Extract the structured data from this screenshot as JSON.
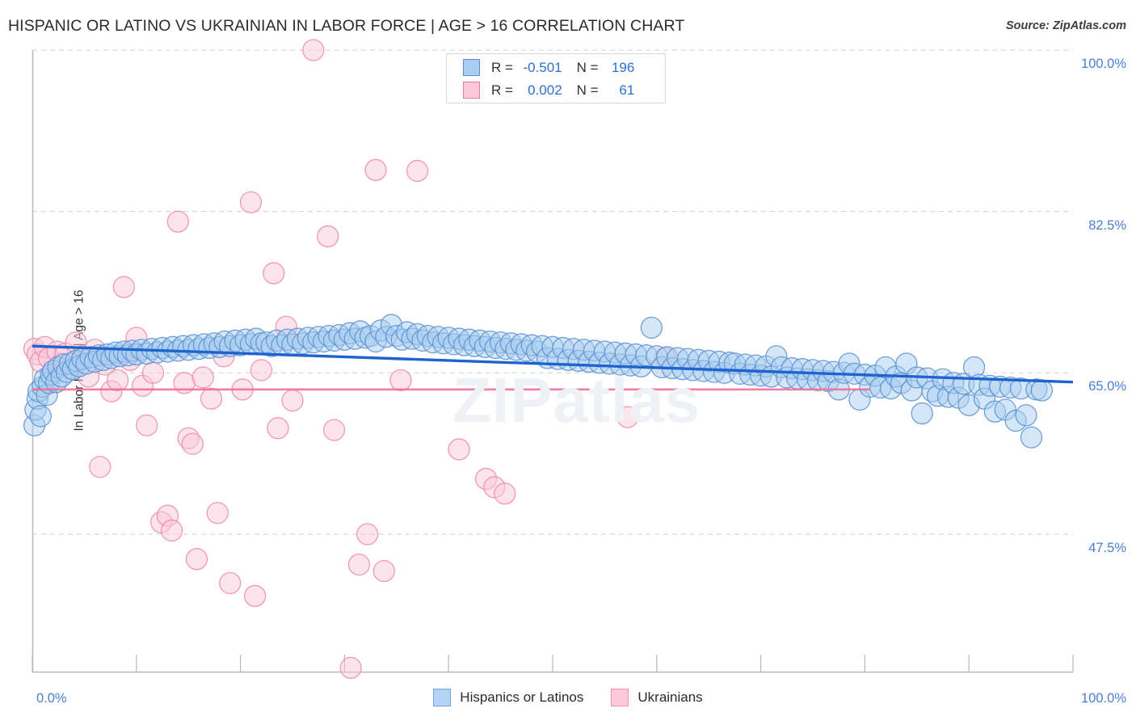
{
  "header": {
    "title": "HISPANIC OR LATINO VS UKRAINIAN IN LABOR FORCE | AGE > 16 CORRELATION CHART",
    "source": "Source: ZipAtlas.com"
  },
  "watermark": "ZIPatlas",
  "stats_legend": {
    "rows": [
      {
        "series": "Hispanics or Latinos",
        "color": "#aacdf2",
        "r_label": "R =",
        "r_value": "-0.501",
        "n_label": "N =",
        "n_value": "196"
      },
      {
        "series": "Ukrainians",
        "color": "#fbc9da",
        "r_label": "R =",
        "r_value": "0.002",
        "n_label": "N =",
        "n_value": "61"
      }
    ]
  },
  "bottom_legend": {
    "items": [
      {
        "label": "Hispanics or Latinos",
        "color": "#b5d4f5"
      },
      {
        "label": "Ukrainians",
        "color": "#fbc9da"
      }
    ]
  },
  "chart_data": {
    "type": "scatter",
    "title": "HISPANIC OR LATINO VS UKRAINIAN IN LABOR FORCE | AGE > 16 CORRELATION CHART",
    "xlabel": "",
    "ylabel": "In Labor Force | Age > 16",
    "xlim": [
      0,
      100
    ],
    "ylim": [
      32.5,
      100
    ],
    "grid": true,
    "legend_position": "bottom-center",
    "x_ticks": [
      "0.0%",
      "100.0%"
    ],
    "x_tick_values": [
      0,
      100
    ],
    "y_ticks": [
      "100.0%",
      "82.5%",
      "65.0%",
      "47.5%"
    ],
    "y_tick_values": [
      100.0,
      82.5,
      65.0,
      47.5
    ],
    "series": [
      {
        "name": "Hispanics or Latinos",
        "color": "#a9cdf0",
        "stroke": "#5b90d4",
        "r": -0.501,
        "n": 196,
        "trendline": {
          "x0": 0,
          "y0": 67.9,
          "x1": 100,
          "y1": 64.0,
          "color": "#1f63d0"
        },
        "points": [
          [
            0.2,
            59.3
          ],
          [
            0.3,
            61.0
          ],
          [
            0.5,
            62.2
          ],
          [
            0.6,
            63.0
          ],
          [
            0.8,
            60.3
          ],
          [
            1.0,
            63.5
          ],
          [
            1.2,
            64.3
          ],
          [
            1.4,
            62.6
          ],
          [
            1.6,
            63.9
          ],
          [
            1.8,
            64.8
          ],
          [
            2.0,
            65.2
          ],
          [
            2.3,
            64.0
          ],
          [
            2.5,
            65.6
          ],
          [
            2.8,
            64.6
          ],
          [
            3.0,
            65.9
          ],
          [
            3.3,
            65.1
          ],
          [
            3.6,
            66.0
          ],
          [
            3.9,
            65.4
          ],
          [
            4.2,
            66.3
          ],
          [
            4.5,
            65.7
          ],
          [
            4.8,
            66.5
          ],
          [
            5.2,
            66.0
          ],
          [
            5.6,
            66.7
          ],
          [
            6.0,
            66.2
          ],
          [
            6.4,
            66.9
          ],
          [
            6.8,
            66.4
          ],
          [
            7.2,
            67.0
          ],
          [
            7.6,
            66.6
          ],
          [
            8.0,
            67.2
          ],
          [
            8.4,
            66.8
          ],
          [
            8.8,
            67.3
          ],
          [
            9.2,
            66.9
          ],
          [
            9.6,
            67.4
          ],
          [
            10.0,
            67.0
          ],
          [
            10.5,
            67.5
          ],
          [
            11.0,
            67.1
          ],
          [
            11.5,
            67.6
          ],
          [
            12.0,
            67.2
          ],
          [
            12.5,
            67.7
          ],
          [
            13.0,
            67.3
          ],
          [
            13.5,
            67.8
          ],
          [
            14.0,
            67.4
          ],
          [
            14.5,
            67.9
          ],
          [
            15.0,
            67.5
          ],
          [
            15.5,
            68.0
          ],
          [
            16.0,
            67.6
          ],
          [
            16.5,
            68.1
          ],
          [
            17.0,
            67.7
          ],
          [
            17.5,
            68.2
          ],
          [
            18.0,
            67.8
          ],
          [
            18.5,
            68.4
          ],
          [
            19.0,
            67.9
          ],
          [
            19.5,
            68.5
          ],
          [
            20.0,
            68.0
          ],
          [
            20.5,
            68.6
          ],
          [
            21.0,
            68.1
          ],
          [
            21.5,
            68.7
          ],
          [
            22.0,
            68.2
          ],
          [
            22.5,
            68.3
          ],
          [
            23.0,
            67.9
          ],
          [
            23.5,
            68.5
          ],
          [
            24.0,
            68.0
          ],
          [
            24.5,
            68.6
          ],
          [
            25.0,
            68.1
          ],
          [
            25.5,
            68.7
          ],
          [
            26.0,
            68.2
          ],
          [
            26.5,
            68.8
          ],
          [
            27.0,
            68.3
          ],
          [
            27.5,
            68.9
          ],
          [
            28.0,
            68.4
          ],
          [
            28.5,
            69.0
          ],
          [
            29.0,
            68.5
          ],
          [
            29.5,
            69.1
          ],
          [
            30.0,
            68.6
          ],
          [
            30.5,
            69.3
          ],
          [
            31.0,
            68.7
          ],
          [
            31.5,
            69.5
          ],
          [
            32.0,
            68.8
          ],
          [
            32.5,
            69.0
          ],
          [
            33.0,
            68.4
          ],
          [
            33.5,
            69.6
          ],
          [
            34.0,
            68.9
          ],
          [
            34.5,
            70.2
          ],
          [
            35.0,
            69.0
          ],
          [
            35.5,
            68.6
          ],
          [
            36.0,
            69.4
          ],
          [
            36.5,
            68.7
          ],
          [
            37.0,
            69.2
          ],
          [
            37.5,
            68.5
          ],
          [
            38.0,
            69.0
          ],
          [
            38.5,
            68.3
          ],
          [
            39.0,
            68.9
          ],
          [
            39.5,
            68.2
          ],
          [
            40.0,
            68.8
          ],
          [
            40.5,
            68.1
          ],
          [
            41.0,
            68.7
          ],
          [
            41.5,
            68.0
          ],
          [
            42.0,
            68.6
          ],
          [
            42.5,
            67.9
          ],
          [
            43.0,
            68.5
          ],
          [
            43.5,
            67.8
          ],
          [
            44.0,
            68.4
          ],
          [
            44.5,
            67.7
          ],
          [
            45.0,
            68.3
          ],
          [
            45.5,
            67.6
          ],
          [
            46.0,
            68.2
          ],
          [
            46.5,
            67.5
          ],
          [
            47.0,
            68.1
          ],
          [
            47.5,
            67.4
          ],
          [
            48.0,
            68.0
          ],
          [
            48.5,
            67.3
          ],
          [
            49.0,
            67.9
          ],
          [
            49.5,
            66.6
          ],
          [
            50.0,
            67.8
          ],
          [
            50.5,
            66.5
          ],
          [
            51.0,
            67.7
          ],
          [
            51.5,
            66.4
          ],
          [
            52.0,
            67.6
          ],
          [
            52.5,
            66.3
          ],
          [
            53.0,
            67.5
          ],
          [
            53.5,
            66.2
          ],
          [
            54.0,
            67.4
          ],
          [
            54.5,
            66.1
          ],
          [
            55.0,
            67.3
          ],
          [
            55.5,
            66.0
          ],
          [
            56.0,
            67.2
          ],
          [
            56.5,
            65.9
          ],
          [
            57.0,
            67.1
          ],
          [
            57.5,
            65.8
          ],
          [
            58.0,
            67.0
          ],
          [
            58.5,
            65.7
          ],
          [
            59.0,
            66.9
          ],
          [
            59.5,
            69.9
          ],
          [
            60.0,
            66.8
          ],
          [
            60.5,
            65.6
          ],
          [
            61.0,
            66.7
          ],
          [
            61.5,
            65.5
          ],
          [
            62.0,
            66.6
          ],
          [
            62.5,
            65.4
          ],
          [
            63.0,
            66.5
          ],
          [
            63.5,
            65.3
          ],
          [
            64.0,
            66.4
          ],
          [
            64.5,
            65.2
          ],
          [
            65.0,
            66.3
          ],
          [
            65.5,
            65.1
          ],
          [
            66.0,
            66.2
          ],
          [
            66.5,
            65.0
          ],
          [
            67.0,
            66.1
          ],
          [
            67.5,
            66.0
          ],
          [
            68.0,
            64.9
          ],
          [
            68.5,
            65.9
          ],
          [
            69.0,
            64.8
          ],
          [
            69.5,
            65.8
          ],
          [
            70.0,
            64.7
          ],
          [
            70.5,
            65.7
          ],
          [
            71.0,
            64.6
          ],
          [
            71.5,
            66.8
          ],
          [
            72.0,
            65.6
          ],
          [
            72.5,
            64.5
          ],
          [
            73.0,
            65.5
          ],
          [
            73.5,
            64.4
          ],
          [
            74.0,
            65.4
          ],
          [
            74.5,
            64.3
          ],
          [
            75.0,
            65.3
          ],
          [
            75.5,
            64.2
          ],
          [
            76.0,
            65.2
          ],
          [
            76.5,
            64.1
          ],
          [
            77.0,
            65.1
          ],
          [
            77.5,
            63.2
          ],
          [
            78.0,
            65.0
          ],
          [
            78.5,
            66.0
          ],
          [
            79.0,
            64.9
          ],
          [
            79.5,
            62.1
          ],
          [
            80.0,
            64.8
          ],
          [
            80.5,
            63.5
          ],
          [
            81.0,
            64.7
          ],
          [
            81.5,
            63.4
          ],
          [
            82.0,
            65.6
          ],
          [
            82.5,
            63.3
          ],
          [
            83.0,
            64.6
          ],
          [
            83.5,
            63.9
          ],
          [
            84.0,
            66.0
          ],
          [
            84.5,
            63.1
          ],
          [
            85.0,
            64.5
          ],
          [
            85.5,
            60.6
          ],
          [
            86.0,
            64.4
          ],
          [
            86.5,
            63.0
          ],
          [
            87.0,
            62.5
          ],
          [
            87.5,
            64.3
          ],
          [
            88.0,
            62.4
          ],
          [
            88.5,
            63.9
          ],
          [
            89.0,
            62.3
          ],
          [
            89.5,
            63.8
          ],
          [
            90.0,
            61.5
          ],
          [
            90.5,
            65.6
          ],
          [
            91.0,
            63.7
          ],
          [
            91.5,
            62.2
          ],
          [
            92.0,
            63.6
          ],
          [
            92.5,
            60.8
          ],
          [
            93.0,
            63.5
          ],
          [
            93.5,
            61.0
          ],
          [
            94.0,
            63.4
          ],
          [
            94.5,
            59.8
          ],
          [
            95.0,
            63.3
          ],
          [
            95.5,
            60.4
          ],
          [
            96.0,
            58.0
          ],
          [
            96.5,
            63.2
          ],
          [
            97.0,
            63.1
          ]
        ]
      },
      {
        "name": "Ukrainians",
        "color": "#fbc9da",
        "stroke": "#ed88ac",
        "r": 0.002,
        "n": 61,
        "trendline": {
          "x0": 0,
          "y0": 63.2,
          "x1": 80.5,
          "y1": 63.2,
          "color": "#ef6f96"
        },
        "points": [
          [
            0.2,
            67.6
          ],
          [
            0.5,
            67.0
          ],
          [
            0.8,
            66.2
          ],
          [
            1.2,
            67.8
          ],
          [
            1.6,
            66.6
          ],
          [
            2.0,
            65.2
          ],
          [
            2.4,
            67.3
          ],
          [
            2.8,
            66.0
          ],
          [
            3.2,
            67.1
          ],
          [
            3.6,
            65.5
          ],
          [
            4.2,
            68.3
          ],
          [
            4.8,
            66.8
          ],
          [
            5.4,
            64.6
          ],
          [
            6.0,
            67.5
          ],
          [
            6.5,
            54.8
          ],
          [
            7.0,
            65.9
          ],
          [
            7.6,
            63.0
          ],
          [
            8.2,
            64.2
          ],
          [
            8.8,
            74.3
          ],
          [
            9.4,
            66.4
          ],
          [
            10.0,
            68.8
          ],
          [
            10.6,
            63.6
          ],
          [
            11.0,
            59.3
          ],
          [
            11.6,
            65.0
          ],
          [
            12.4,
            48.8
          ],
          [
            13.0,
            49.5
          ],
          [
            13.4,
            47.9
          ],
          [
            14.0,
            81.4
          ],
          [
            14.6,
            63.9
          ],
          [
            15.0,
            57.9
          ],
          [
            15.4,
            57.3
          ],
          [
            15.8,
            44.8
          ],
          [
            16.4,
            64.5
          ],
          [
            17.2,
            62.2
          ],
          [
            17.8,
            49.8
          ],
          [
            18.4,
            66.8
          ],
          [
            19.0,
            42.2
          ],
          [
            20.2,
            63.2
          ],
          [
            21.0,
            83.5
          ],
          [
            21.4,
            40.8
          ],
          [
            22.0,
            65.3
          ],
          [
            23.2,
            75.8
          ],
          [
            23.6,
            59.0
          ],
          [
            24.4,
            70.0
          ],
          [
            25.0,
            62.0
          ],
          [
            27.0,
            100.0
          ],
          [
            28.4,
            79.8
          ],
          [
            29.0,
            58.8
          ],
          [
            31.4,
            44.2
          ],
          [
            32.2,
            47.5
          ],
          [
            33.0,
            87.0
          ],
          [
            33.8,
            43.5
          ],
          [
            35.4,
            64.2
          ],
          [
            37.0,
            86.9
          ],
          [
            41.0,
            56.7
          ],
          [
            43.6,
            53.5
          ],
          [
            44.4,
            52.6
          ],
          [
            45.4,
            51.9
          ],
          [
            57.2,
            60.2
          ],
          [
            60.8,
            66.6
          ],
          [
            30.6,
            33.0
          ]
        ]
      }
    ]
  }
}
